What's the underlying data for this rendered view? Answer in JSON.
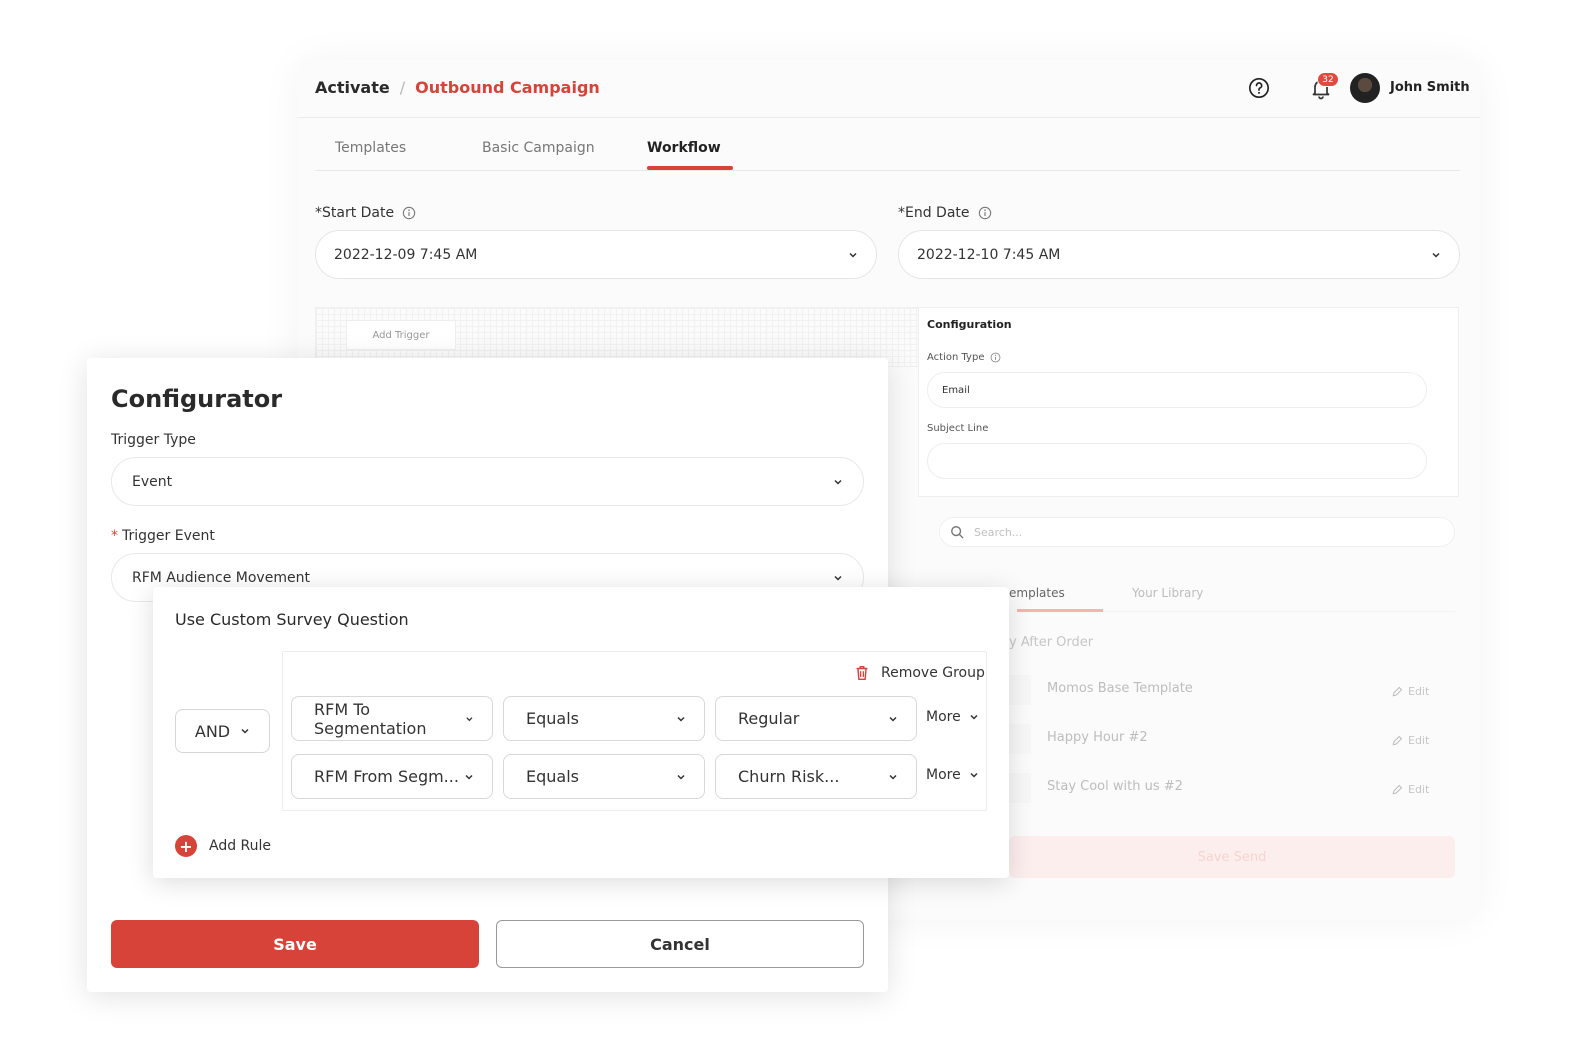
{
  "header": {
    "breadcrumb_root": "Activate",
    "breadcrumb_sep": "/",
    "breadcrumb_current": "Outbound Campaign",
    "notification_count": "32",
    "user_name": "John Smith"
  },
  "tabs": [
    {
      "label": "Templates"
    },
    {
      "label": "Basic Campaign"
    },
    {
      "label": "Workflow"
    }
  ],
  "dates": {
    "start_label": "*Start Date",
    "start_value": "2022-12-09 7:45 AM",
    "end_label": "*End Date",
    "end_value": "2022-12-10 7:45 AM"
  },
  "canvas": {
    "add_trigger": "Add Trigger"
  },
  "configuration": {
    "title": "Configuration",
    "action_type_label": "Action Type",
    "action_type_value": "Email",
    "subject_label": "Subject Line",
    "subject_value": ""
  },
  "library": {
    "search_placeholder": "Search...",
    "tab_templates": "emplates",
    "tab_library": "Your Library",
    "section": "y After Order",
    "templates": [
      {
        "name": "Momos Base Template",
        "edit": "Edit"
      },
      {
        "name": "Happy Hour #2",
        "edit": "Edit"
      },
      {
        "name": "Stay Cool with us #2",
        "edit": "Edit"
      }
    ],
    "save_send": "Save Send"
  },
  "configurator": {
    "title": "Configurator",
    "trigger_type_label": "Trigger Type",
    "trigger_type_value": "Event",
    "trigger_event_req": "*",
    "trigger_event_label": "Trigger Event",
    "trigger_event_value": "RFM Audience Movement",
    "save": "Save",
    "cancel": "Cancel"
  },
  "survey": {
    "title": "Use Custom Survey Question",
    "logic": "AND",
    "remove_group": "Remove Group",
    "rules": [
      {
        "field": "RFM To Segmentation",
        "operator": "Equals",
        "value": "Regular",
        "more": "More"
      },
      {
        "field": "RFM From Segm...",
        "operator": "Equals",
        "value": "Churn Risk...",
        "more": "More"
      }
    ],
    "add_rule": "Add Rule"
  },
  "colors": {
    "accent": "#d84339",
    "badge": "#e34a3f"
  }
}
